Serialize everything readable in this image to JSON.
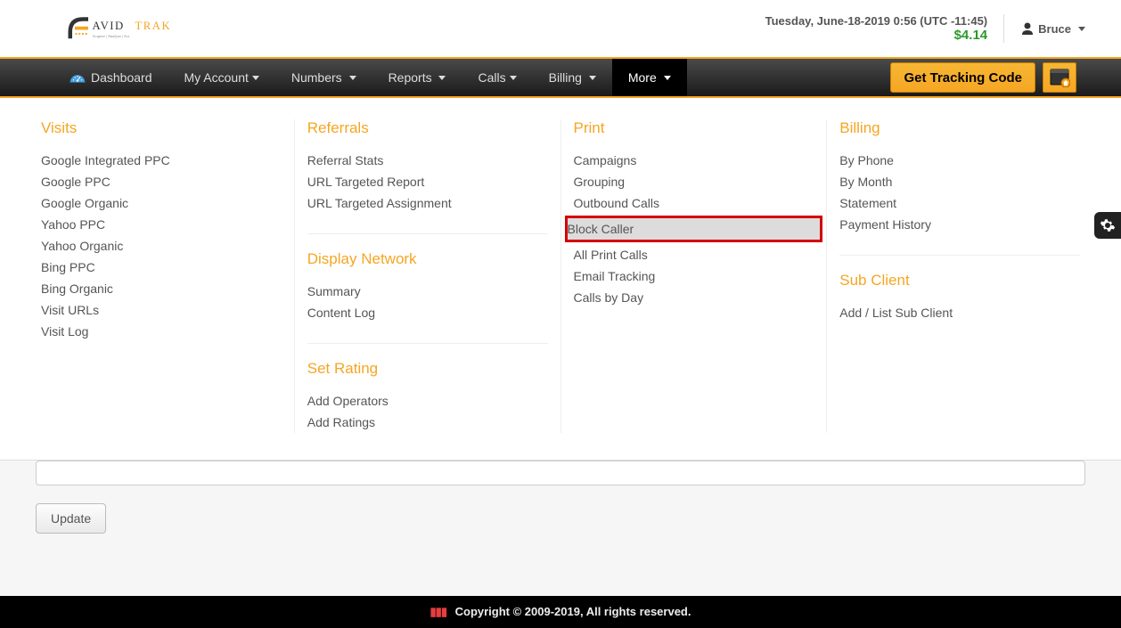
{
  "header": {
    "datetime": "Tuesday, June-18-2019 0:56 (UTC -11:45)",
    "balance": "$4.14",
    "user": "Bruce"
  },
  "nav": {
    "dashboard": "Dashboard",
    "my_account": "My Account",
    "numbers": "Numbers",
    "reports": "Reports",
    "calls": "Calls",
    "billing": "Billing",
    "more": "More",
    "tracking_btn": "Get Tracking Code"
  },
  "mega": {
    "visits": {
      "title": "Visits",
      "items": [
        "Google Integrated PPC",
        "Google PPC",
        "Google Organic",
        "Yahoo PPC",
        "Yahoo Organic",
        "Bing PPC",
        "Bing Organic",
        "Visit URLs",
        "Visit Log"
      ]
    },
    "referrals": {
      "title": "Referrals",
      "items": [
        "Referral Stats",
        "URL Targeted Report",
        "URL Targeted Assignment"
      ]
    },
    "display_network": {
      "title": "Display Network",
      "items": [
        "Summary",
        "Content Log"
      ]
    },
    "set_rating": {
      "title": "Set Rating",
      "items": [
        "Add Operators",
        "Add Ratings"
      ]
    },
    "print": {
      "title": "Print",
      "items": [
        "Campaigns",
        "Grouping",
        "Outbound Calls",
        "Block Caller",
        "All Print Calls",
        "Email Tracking",
        "Calls by Day"
      ]
    },
    "billing": {
      "title": "Billing",
      "items": [
        "By Phone",
        "By Month",
        "Statement",
        "Payment History"
      ]
    },
    "sub_client": {
      "title": "Sub Client",
      "items": [
        "Add / List Sub Client"
      ]
    }
  },
  "content": {
    "update_btn": "Update"
  },
  "footer": {
    "copyright": "Copyright © 2009-2019, All rights reserved."
  }
}
